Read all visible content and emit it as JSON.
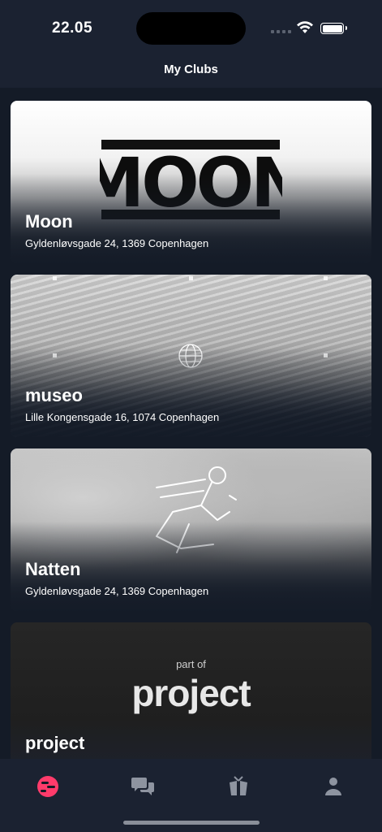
{
  "status_bar": {
    "time": "22.05"
  },
  "header": {
    "title": "My Clubs"
  },
  "clubs": [
    {
      "name": "Moon",
      "address": "Gyldenløvsgade 24, 1369 Copenhagen",
      "logo_text": "MOON"
    },
    {
      "name": "museo",
      "address": "Lille Kongensgade 16, 1074 Copenhagen"
    },
    {
      "name": "Natten",
      "address": "Gyldenløvsgade 24, 1369 Copenhagen"
    },
    {
      "name": "project",
      "logo_small": "part of",
      "logo_text": "project"
    }
  ],
  "tab_bar": {
    "items": [
      {
        "icon": "clubs-icon",
        "active": true
      },
      {
        "icon": "chat-icon",
        "active": false
      },
      {
        "icon": "gift-icon",
        "active": false
      },
      {
        "icon": "profile-icon",
        "active": false
      }
    ]
  },
  "colors": {
    "accent": "#ff3b6b",
    "background": "#141b27",
    "bar": "#1b2231",
    "inactive_icon": "#8e94a0"
  }
}
